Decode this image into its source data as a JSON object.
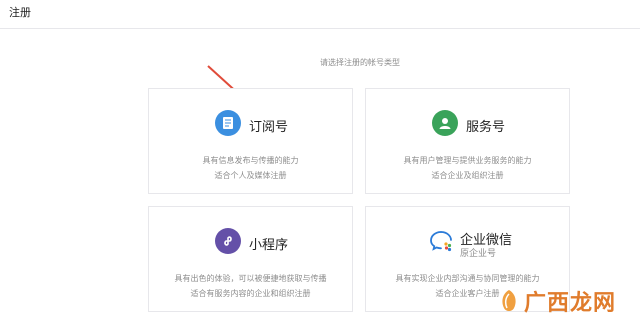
{
  "header": {
    "title": "注册"
  },
  "prompt": "请选择注册的帐号类型",
  "accounts": [
    {
      "title": "订阅号",
      "icon": "document-icon",
      "color": "#3b8fe0",
      "desc1": "具有信息发布与传播的能力",
      "desc2": "适合个人及媒体注册"
    },
    {
      "title": "服务号",
      "icon": "user-icon",
      "color": "#3aa35a",
      "desc1": "具有用户管理与提供业务服务的能力",
      "desc2": "适合企业及组织注册"
    },
    {
      "title": "小程序",
      "icon": "miniprogram-icon",
      "color": "#6450a8",
      "desc1": "具有出色的体验，可以被便捷地获取与传播",
      "desc2": "适合有服务内容的企业和组织注册"
    },
    {
      "title": "企业微信",
      "subtitle": "原企业号",
      "icon": "wework-icon",
      "color": "#2b7bd8",
      "desc1": "具有实现企业内部沟通与协同管理的能力",
      "desc2": "适合企业客户注册"
    }
  ],
  "watermark": {
    "text": "广西龙网"
  }
}
